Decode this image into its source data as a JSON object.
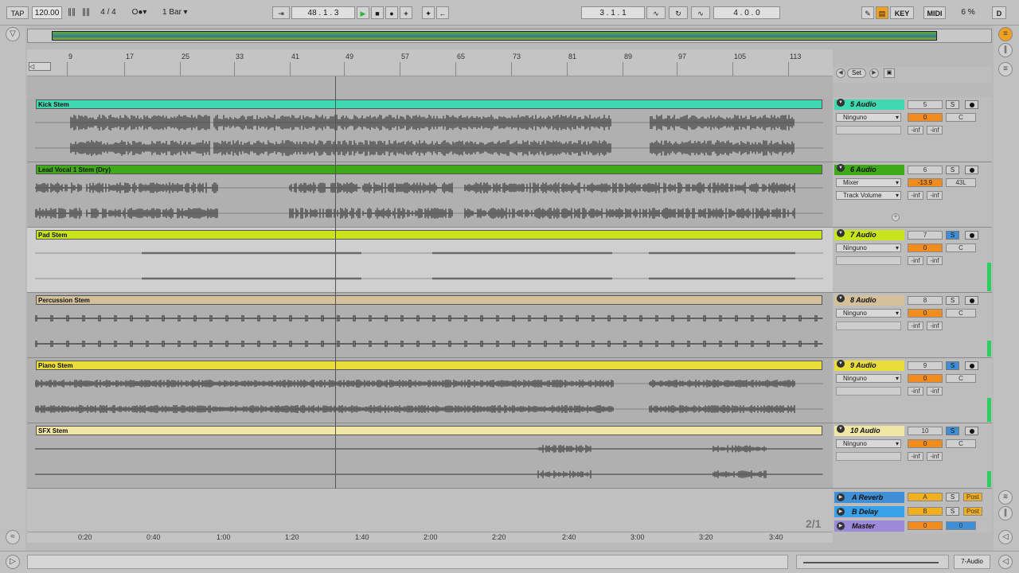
{
  "transport": {
    "tap": "TAP",
    "tempo": "120.00",
    "time_sig": "4 / 4",
    "quantize": "1 Bar",
    "arr_position": "48 .  1 .  3",
    "punch_in": "3 .  1 .  1",
    "loop_length": "4 .  0 .  0",
    "key_label": "KEY",
    "midi_label": "MIDI",
    "cpu": "6 %",
    "disk": "D"
  },
  "ruler": {
    "bars": [
      "9",
      "17",
      "25",
      "33",
      "41",
      "49",
      "57",
      "65",
      "73",
      "81",
      "89",
      "97",
      "105",
      "113"
    ],
    "set_label": "Set"
  },
  "tracks": [
    {
      "clip": "Kick Stem",
      "name": "5 Audio",
      "color": "#3fd8b0",
      "input": "Ninguno",
      "num": "5",
      "vol": "0",
      "pan": "C",
      "solo": "S",
      "solo_on": false
    },
    {
      "clip": "Lead Vocal 1 Stem (Dry)",
      "name": "6 Audio",
      "color": "#3faa18",
      "input": "Mixer",
      "input2": "Track Volume",
      "num": "6",
      "vol": "-13.9",
      "pan": "43L",
      "solo": "S",
      "solo_on": false
    },
    {
      "clip": "Pad Stem",
      "name": "7 Audio",
      "color": "#c8e41c",
      "input": "Ninguno",
      "num": "7",
      "vol": "0",
      "pan": "C",
      "solo": "S",
      "solo_on": true
    },
    {
      "clip": "Percussion Stem",
      "name": "8 Audio",
      "color": "#d4c09a",
      "input": "Ninguno",
      "num": "8",
      "vol": "0",
      "pan": "C",
      "solo": "S",
      "solo_on": false
    },
    {
      "clip": "Piano Stem",
      "name": "9 Audio",
      "color": "#eadc3a",
      "input": "Ninguno",
      "num": "9",
      "vol": "0",
      "pan": "C",
      "solo": "S",
      "solo_on": true
    },
    {
      "clip": "SFX Stem",
      "name": "10 Audio",
      "color": "#f0e6a6",
      "input": "Ninguno",
      "num": "10",
      "vol": "0",
      "pan": "C",
      "solo": "S",
      "solo_on": true
    }
  ],
  "inf": "-inf",
  "returns": [
    {
      "name": "A Reverb",
      "color": "#3f8fd6",
      "send": "A",
      "solo": "S",
      "post": "Post"
    },
    {
      "name": "B Delay",
      "color": "#3aa0e8",
      "send": "B",
      "solo": "S",
      "post": "Post"
    },
    {
      "name": "Master",
      "color": "#9a8ad8",
      "send": "0",
      "vol2": "0"
    }
  ],
  "page_indicator": "2/1",
  "times": [
    "0:20",
    "0:40",
    "1:00",
    "1:20",
    "1:40",
    "2:00",
    "2:20",
    "2:40",
    "3:00",
    "3:20",
    "3:40"
  ],
  "status": {
    "selected_track": "7-Audio"
  }
}
